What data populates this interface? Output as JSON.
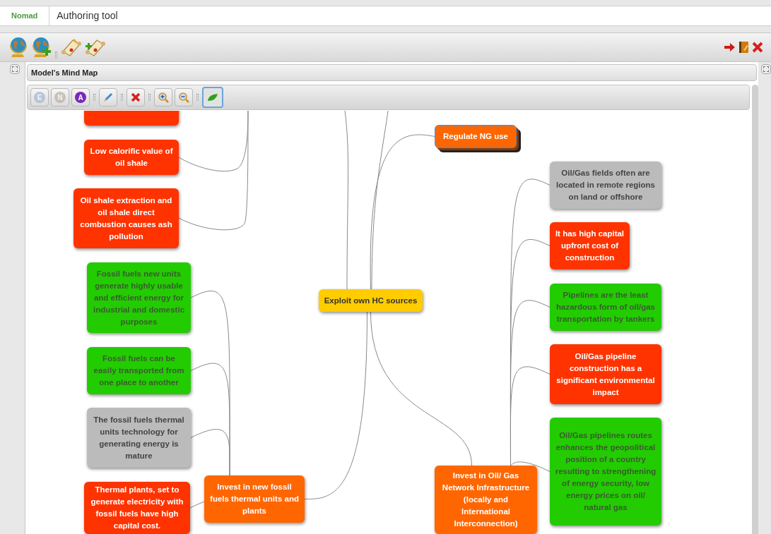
{
  "breadcrumb": [
    {
      "label": "Nomad"
    },
    {
      "label": "Authoring tool"
    }
  ],
  "panel": {
    "title": "Model's Mind Map"
  },
  "map_toolbar": {
    "filters": [
      {
        "label": "E",
        "disabled": true
      },
      {
        "label": "N",
        "disabled": true
      },
      {
        "label": "A",
        "disabled": false
      }
    ],
    "leaf_toggle": {
      "on": true
    }
  },
  "mind_map": {
    "root": {
      "kind": "root",
      "text": "Exploit own HC sources",
      "selected": false,
      "children": [
        {
          "kind": "action",
          "text": "Invest in new fossil fuels thermal units and plants",
          "selected": false,
          "children": [
            {
              "kind": "positive",
              "text": "Fossil fuels new units generate highly usable and efficient energy for industrial and domestic purposes",
              "selected": false
            },
            {
              "kind": "positive",
              "text": "Fossil fuels can be easily transported from one place to another",
              "selected": false
            },
            {
              "kind": "neutral",
              "text": "The fossil fuels thermal units technology for generating energy is mature",
              "selected": false
            },
            {
              "kind": "negative",
              "text": "Thermal plants, set to generate electricity with fossil fuels have high capital cost.",
              "selected": false
            }
          ]
        },
        {
          "kind": "action",
          "text": "Regulate NG use",
          "selected": true
        },
        {
          "kind": "action",
          "text": "Invest in Oil/ Gas Network Infrastructure (locally and International Interconnection)",
          "selected": false,
          "children": [
            {
              "kind": "neutral",
              "text": "Oil/Gas fields often are located in remote regions on land or offshore",
              "selected": false
            },
            {
              "kind": "negative",
              "text": "It has high capital upfront cost of construction",
              "selected": false
            },
            {
              "kind": "positive",
              "text": "Pipelines are the least hazardous form of oil/gas transportation by tankers",
              "selected": false
            },
            {
              "kind": "negative",
              "text": "Oil/Gas pipeline construction has a significant environmental impact",
              "selected": false
            },
            {
              "kind": "positive",
              "text": "Oil/Gas pipelines routes enhances the geopolitical position of a country resulting to strengthening of energy security, low energy prices on oil/ natural gas",
              "selected": false
            }
          ]
        }
      ]
    },
    "offscreen_branch_nodes": [
      {
        "kind": "negative",
        "selected": false
      },
      {
        "kind": "negative",
        "text": "Low calorific value of oil shale",
        "selected": false
      },
      {
        "kind": "negative",
        "text": "Oil shale extraction and oil shale direct combustion causes ash pollution",
        "selected": false
      }
    ]
  }
}
